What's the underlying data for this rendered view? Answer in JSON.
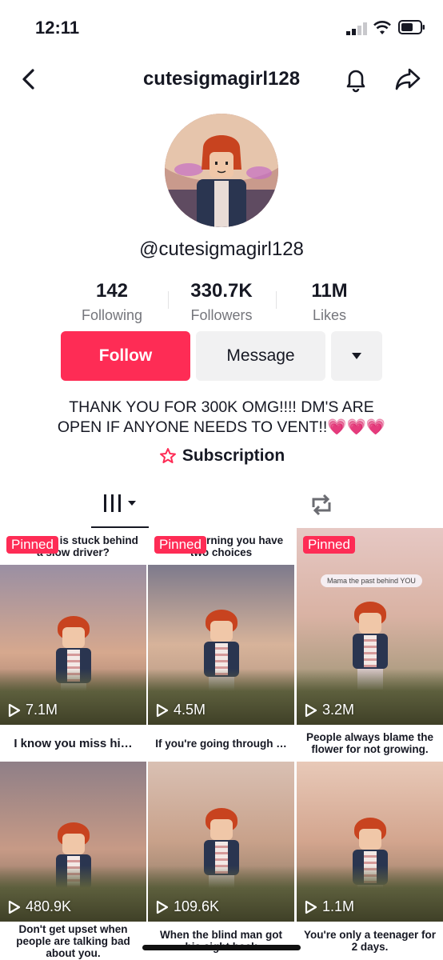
{
  "status_bar": {
    "time": "12:11"
  },
  "header": {
    "username": "cutesigmagirl128"
  },
  "profile": {
    "handle": "@cutesigmagirl128",
    "stats": [
      {
        "value": "142",
        "label": "Following"
      },
      {
        "value": "330.7K",
        "label": "Followers"
      },
      {
        "value": "11M",
        "label": "Likes"
      }
    ],
    "follow_label": "Follow",
    "message_label": "Message",
    "bio_line1": "THANK YOU FOR 300K OMG!!!! DM'S ARE",
    "bio_line2": "OPEN IF ANYONE NEEDS TO VENT!!💗💗💗",
    "subscription_label": "Subscription"
  },
  "colors": {
    "accent": "#fe2c55",
    "secondary_btn": "#f1f1f2",
    "muted_text": "#75767c"
  },
  "videos": [
    {
      "caption": "Someone is stuck behind a slow driver?",
      "pinned": true,
      "pinned_label": "Pinned",
      "views": "7.1M"
    },
    {
      "caption": "every morning you have two choices",
      "pinned": true,
      "pinned_label": "Pinned",
      "views": "4.5M"
    },
    {
      "caption": "Mama the past behind YOU",
      "pinned": true,
      "pinned_label": "Pinned",
      "views": "3.2M"
    },
    {
      "caption": "I know you miss hi…",
      "pinned": false,
      "views": "480.9K"
    },
    {
      "caption": "If you're going through …",
      "pinned": false,
      "views": "109.6K"
    },
    {
      "caption": "People always blame the flower for not growing.",
      "pinned": false,
      "views": "1.1M"
    }
  ],
  "bottom_captions": [
    "Don't get upset when people are talking bad about you.",
    "When the blind man got his sight back",
    "You're only a teenager for 2 days."
  ]
}
